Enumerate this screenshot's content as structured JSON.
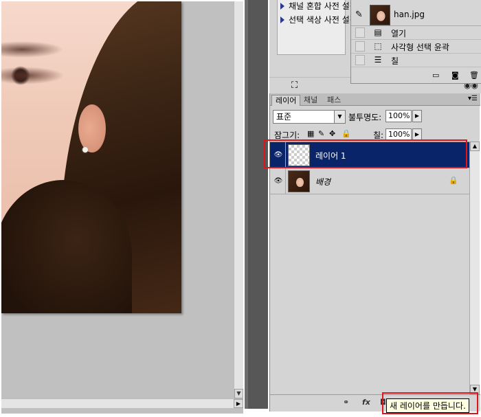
{
  "actions": {
    "row1": "채널 혼합 사전 설정",
    "row2": "선택 색상 사전 설정"
  },
  "history": {
    "snapshot_name": "han.jpg",
    "items": [
      {
        "label": "열기",
        "icon": "open-document-icon"
      },
      {
        "label": "사각형 선택 윤곽",
        "icon": "marquee-selection-icon"
      },
      {
        "label": "칠",
        "icon": "fill-icon"
      }
    ]
  },
  "layers_panel": {
    "tabs": [
      "레이어",
      "채널",
      "패스"
    ],
    "active_tab": "레이어",
    "blend_mode": "표준",
    "opacity_label": "불투명도:",
    "opacity_value": "100%",
    "lock_label": "잠그기:",
    "fill_label": "칠:",
    "fill_value": "100%",
    "layers": [
      {
        "name": "레이어 1",
        "selected": true,
        "thumbnail": "transparent"
      },
      {
        "name": "배경",
        "selected": false,
        "thumbnail": "photo",
        "locked": true
      }
    ]
  },
  "tooltip": {
    "text": "새 레이어를 만듭니다."
  },
  "icons": {
    "eye": "eye-icon",
    "lock": "lock-icon",
    "brush": "history-brush-icon",
    "link": "link-layers-icon",
    "fx": "layer-style-icon"
  },
  "colors": {
    "selection": "#0a246a",
    "highlight_box": "#e0141a",
    "panel_bg": "#d4d4d4",
    "tooltip_bg": "#ffffe1"
  }
}
